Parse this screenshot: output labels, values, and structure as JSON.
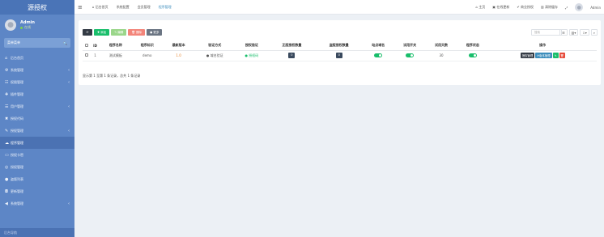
{
  "sidebar": {
    "logo": "源授权",
    "user": {
      "name": "Admin",
      "status": "在线"
    },
    "menu_header": "菜单菜单",
    "menu_search_icon": "search-icon",
    "items": [
      {
        "label": "后台首页",
        "icon": "⌂",
        "chevron": false,
        "active": false
      },
      {
        "label": "系统管理",
        "icon": "⚙",
        "chevron": true,
        "active": false
      },
      {
        "label": "权限管理",
        "icon": "☷",
        "chevron": true,
        "active": false
      },
      {
        "label": "插件管理",
        "icon": "✚",
        "chevron": false,
        "active": false
      },
      {
        "label": "用户管理",
        "icon": "☰",
        "chevron": true,
        "active": false
      },
      {
        "label": "授权代码",
        "icon": "✖",
        "chevron": false,
        "active": false
      },
      {
        "label": "授权管理",
        "icon": "✎",
        "chevron": true,
        "active": false
      },
      {
        "label": "程序管理",
        "icon": "☁",
        "chevron": false,
        "active": true
      },
      {
        "label": "授权卡密",
        "icon": "▭",
        "chevron": false,
        "active": false
      },
      {
        "label": "授权管理",
        "icon": "◎",
        "chevron": false,
        "active": false
      },
      {
        "label": "盗版列表",
        "icon": "●",
        "chevron": false,
        "active": false
      },
      {
        "label": "更新管理",
        "icon": "◘",
        "chevron": false,
        "active": false
      },
      {
        "label": "系统管理",
        "icon": "◀",
        "chevron": true,
        "active": false
      }
    ],
    "footer": "后台导航"
  },
  "topbar": {
    "tabs": [
      "后台首页",
      "系统配置",
      "会员管理",
      "程序管理"
    ],
    "active_tab": 3,
    "right": [
      "主页",
      "在线更新",
      "商业授权",
      "清除缓存"
    ],
    "user": "Admin"
  },
  "toolbar": {
    "refresh": "⟳",
    "add": "添加",
    "edit": "编辑",
    "delete": "删除",
    "more": "更多",
    "search_placeholder": "搜索"
  },
  "table": {
    "headers": [
      "ID",
      "程序名称",
      "程序标识",
      "最新版本",
      "验证方式",
      "授权验证",
      "正版授权数量",
      "盗版授权数量",
      "站点域名",
      "试用开关",
      "试用天数",
      "程序状态",
      "操作"
    ],
    "rows": [
      {
        "id": "1",
        "name": "测试模板",
        "key": "demo",
        "version": "1.0",
        "verify": "域名验证",
        "auth": "授权码",
        "genuine": "0",
        "pirated": "0",
        "trial_days": "30"
      }
    ],
    "ops": [
      "授权管理",
      "版本管理"
    ]
  },
  "pagination": "显示第 1 至第 1 条记录，总共 1 条记录"
}
